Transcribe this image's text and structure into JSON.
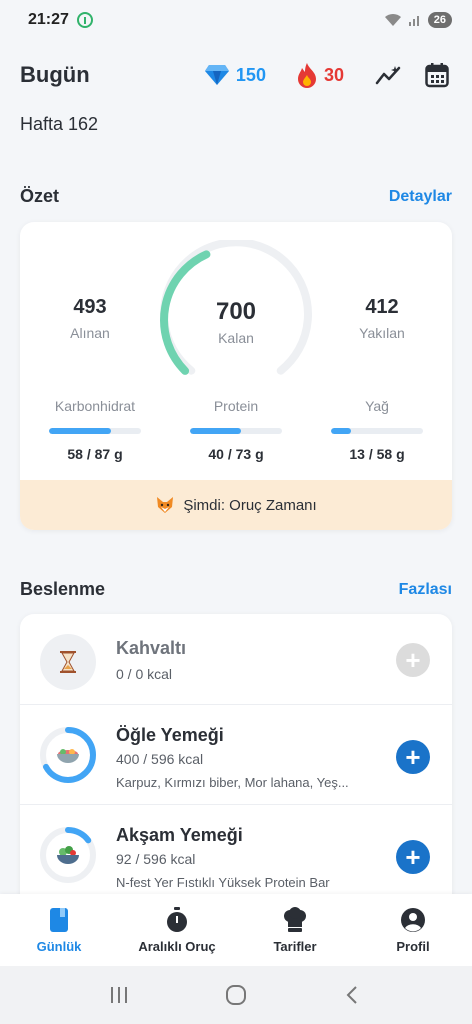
{
  "status_bar": {
    "time": "21:27",
    "battery": "26"
  },
  "header": {
    "title": "Bugün",
    "gems": "150",
    "streak": "30"
  },
  "week": "Hafta 162",
  "summary": {
    "title": "Özet",
    "link": "Detaylar",
    "eaten": {
      "value": "493",
      "label": "Alınan"
    },
    "remaining": {
      "value": "700",
      "label": "Kalan"
    },
    "burned": {
      "value": "412",
      "label": "Yakılan"
    },
    "gauge_fraction": 0.41,
    "macros": [
      {
        "label": "Karbonhidrat",
        "value": "58 / 87 g",
        "fraction": 0.67
      },
      {
        "label": "Protein",
        "value": "40 / 73 g",
        "fraction": 0.55
      },
      {
        "label": "Yağ",
        "value": "13 / 58 g",
        "fraction": 0.22
      }
    ],
    "fasting_text": "Şimdi: Oruç Zamanı"
  },
  "nutrition": {
    "title": "Beslenme",
    "link": "Fazlası",
    "meals": [
      {
        "name": "Kahvaltı",
        "kcal": "0 / 0 kcal",
        "items": "",
        "fraction": 0
      },
      {
        "name": "Öğle Yemeği",
        "kcal": "400 / 596 kcal",
        "items": "Karpuz, Kırmızı biber, Mor lahana, Yeş...",
        "fraction": 0.67
      },
      {
        "name": "Akşam Yemeği",
        "kcal": "92 / 596 kcal",
        "items": "N-fest Yer Fıstıklı Yüksek Protein Bar",
        "fraction": 0.15
      }
    ]
  },
  "nav": [
    {
      "label": "Günlük",
      "icon": "diary-icon"
    },
    {
      "label": "Aralıklı Oruç",
      "icon": "stopwatch-icon"
    },
    {
      "label": "Tarifler",
      "icon": "chef-hat-icon"
    },
    {
      "label": "Profil",
      "icon": "profile-icon"
    }
  ],
  "colors": {
    "accent": "#1e88e5",
    "gauge": "#6fd3b0",
    "progress": "#42a5f5",
    "streak": "#e53935",
    "fasting_bg": "#fcebd5"
  }
}
